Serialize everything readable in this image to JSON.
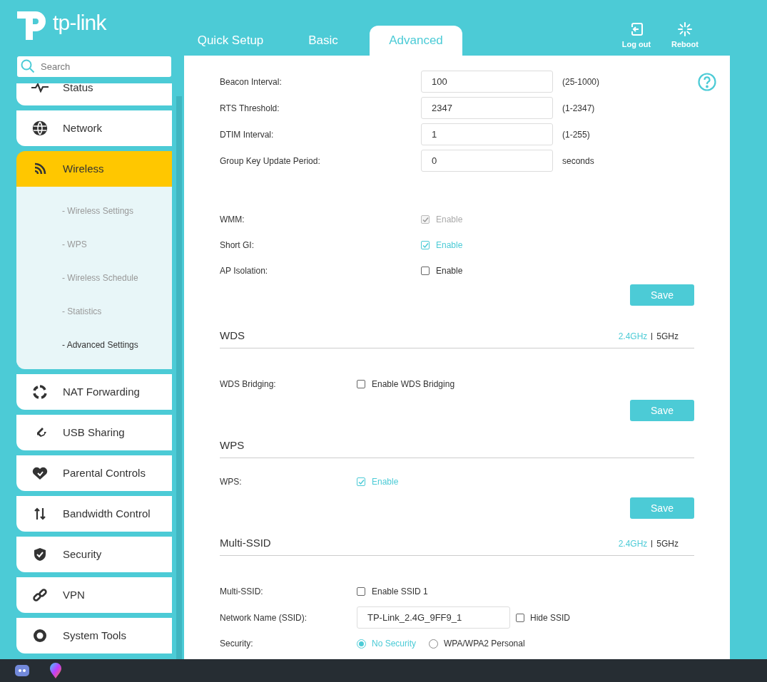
{
  "header": {
    "logo": "tp-link",
    "tabs": [
      {
        "label": "Quick Setup",
        "selected": false
      },
      {
        "label": "Basic",
        "selected": false
      },
      {
        "label": "Advanced",
        "selected": true
      }
    ],
    "actions": [
      {
        "kind": "logout",
        "label": "Log out"
      },
      {
        "kind": "reboot",
        "label": "Reboot"
      }
    ]
  },
  "sidebar": {
    "search": {
      "placeholder": "Search"
    },
    "items": [
      {
        "kind": "pulse",
        "label": "Status",
        "selected": false,
        "expanded": false
      },
      {
        "kind": "globe",
        "label": "Network",
        "selected": false,
        "expanded": false
      },
      {
        "kind": "wifi",
        "label": "Wireless",
        "selected": true,
        "expanded": true,
        "children": [
          {
            "label": "- Wireless Settings",
            "selected": false
          },
          {
            "label": "- WPS",
            "selected": false
          },
          {
            "label": "- Wireless Schedule",
            "selected": false
          },
          {
            "label": "- Statistics",
            "selected": false
          },
          {
            "label": "- Advanced Settings",
            "selected": true
          }
        ]
      },
      {
        "kind": "cycle",
        "label": "NAT Forwarding",
        "selected": false,
        "expanded": false
      },
      {
        "kind": "usb",
        "label": "USB Sharing",
        "selected": false,
        "expanded": false
      },
      {
        "kind": "heart",
        "label": "Parental Controls",
        "selected": false,
        "expanded": false
      },
      {
        "kind": "updown",
        "label": "Bandwidth Control",
        "selected": false,
        "expanded": false
      },
      {
        "kind": "shield",
        "label": "Security",
        "selected": false,
        "expanded": false
      },
      {
        "kind": "link",
        "label": "VPN",
        "selected": false,
        "expanded": false
      },
      {
        "kind": "gear",
        "label": "System Tools",
        "selected": false,
        "expanded": false
      }
    ]
  },
  "sections": [
    {
      "rows": [
        {
          "kind": "input",
          "label": "Beacon Interval:",
          "value": "100",
          "hint": "(25-1000)"
        },
        {
          "kind": "input",
          "label": "RTS Threshold:",
          "value": "2347",
          "hint": "(1-2347)"
        },
        {
          "kind": "input",
          "label": "DTIM Interval:",
          "value": "1",
          "hint": "(1-255)"
        },
        {
          "kind": "input",
          "label": "Group Key Update Period:",
          "value": "0",
          "hint": "seconds"
        },
        {
          "kind": "checkbox",
          "label": "WMM:",
          "option": "Enable",
          "checked": true,
          "disabled": true
        },
        {
          "kind": "checkbox",
          "label": "Short GI:",
          "option": "Enable",
          "checked": true,
          "disabled": false
        },
        {
          "kind": "checkbox",
          "label": "AP Isolation:",
          "option": "Enable",
          "checked": false,
          "disabled": false
        }
      ],
      "save": "Save"
    },
    {
      "title": "WDS",
      "bands": [
        {
          "label": "2.4GHz",
          "selected": true
        },
        {
          "label": "5GHz",
          "selected": false
        }
      ],
      "rows": [
        {
          "kind": "checkbox",
          "label": "WDS Bridging:",
          "option": "Enable WDS Bridging",
          "checked": false,
          "disabled": false
        }
      ],
      "save": "Save"
    },
    {
      "title": "WPS",
      "rows": [
        {
          "kind": "checkbox",
          "label": "WPS:",
          "option": "Enable",
          "checked": true,
          "disabled": false
        }
      ],
      "save": "Save"
    },
    {
      "title": "Multi-SSID",
      "bands": [
        {
          "label": "2.4GHz",
          "selected": true
        },
        {
          "label": "5GHz",
          "selected": false
        }
      ],
      "rows": [
        {
          "kind": "checkbox",
          "label": "Multi-SSID:",
          "option": "Enable SSID 1",
          "checked": false,
          "disabled": false
        },
        {
          "kind": "ssid",
          "label": "Network Name (SSID):",
          "value": "TP-Link_2.4G_9FF9_1",
          "option": "Hide SSID",
          "checked": false
        },
        {
          "kind": "radio",
          "label": "Security:",
          "options": [
            {
              "label": "No Security",
              "selected": true
            },
            {
              "label": "WPA/WPA2 Personal",
              "selected": false
            }
          ]
        }
      ]
    }
  ],
  "taskbar": {
    "apps": [
      {
        "kind": "chat"
      },
      {
        "kind": "balloon"
      }
    ]
  }
}
